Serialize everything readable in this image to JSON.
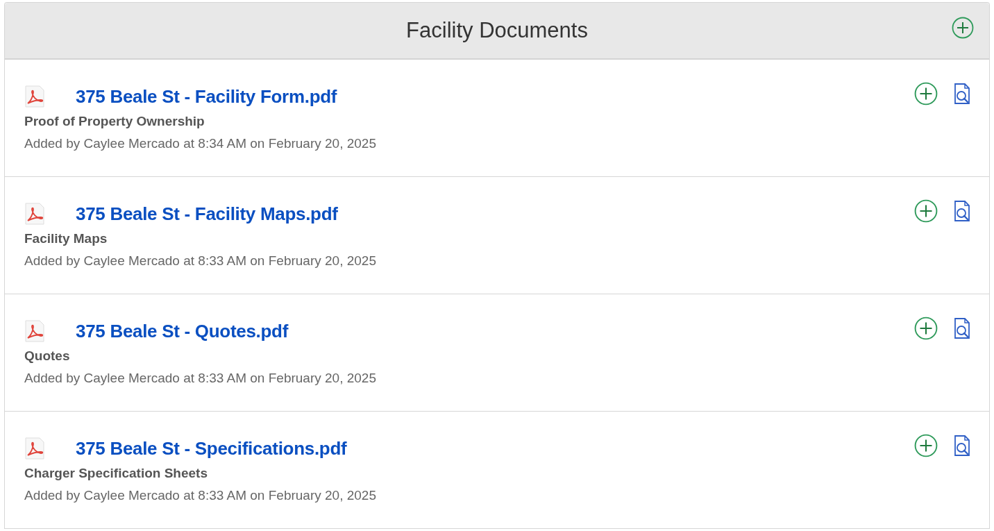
{
  "panel": {
    "title": "Facility Documents"
  },
  "documents": [
    {
      "name": "375 Beale St - Facility Form.pdf",
      "category": "Proof of Property Ownership",
      "added": "Added by Caylee Mercado at 8:34 AM on February 20, 2025"
    },
    {
      "name": "375 Beale St - Facility Maps.pdf",
      "category": "Facility Maps",
      "added": "Added by Caylee Mercado at 8:33 AM on February 20, 2025"
    },
    {
      "name": "375 Beale St - Quotes.pdf",
      "category": "Quotes",
      "added": "Added by Caylee Mercado at 8:33 AM on February 20, 2025"
    },
    {
      "name": "375 Beale St - Specifications.pdf",
      "category": "Charger Specification Sheets",
      "added": "Added by Caylee Mercado at 8:33 AM on February 20, 2025"
    }
  ]
}
